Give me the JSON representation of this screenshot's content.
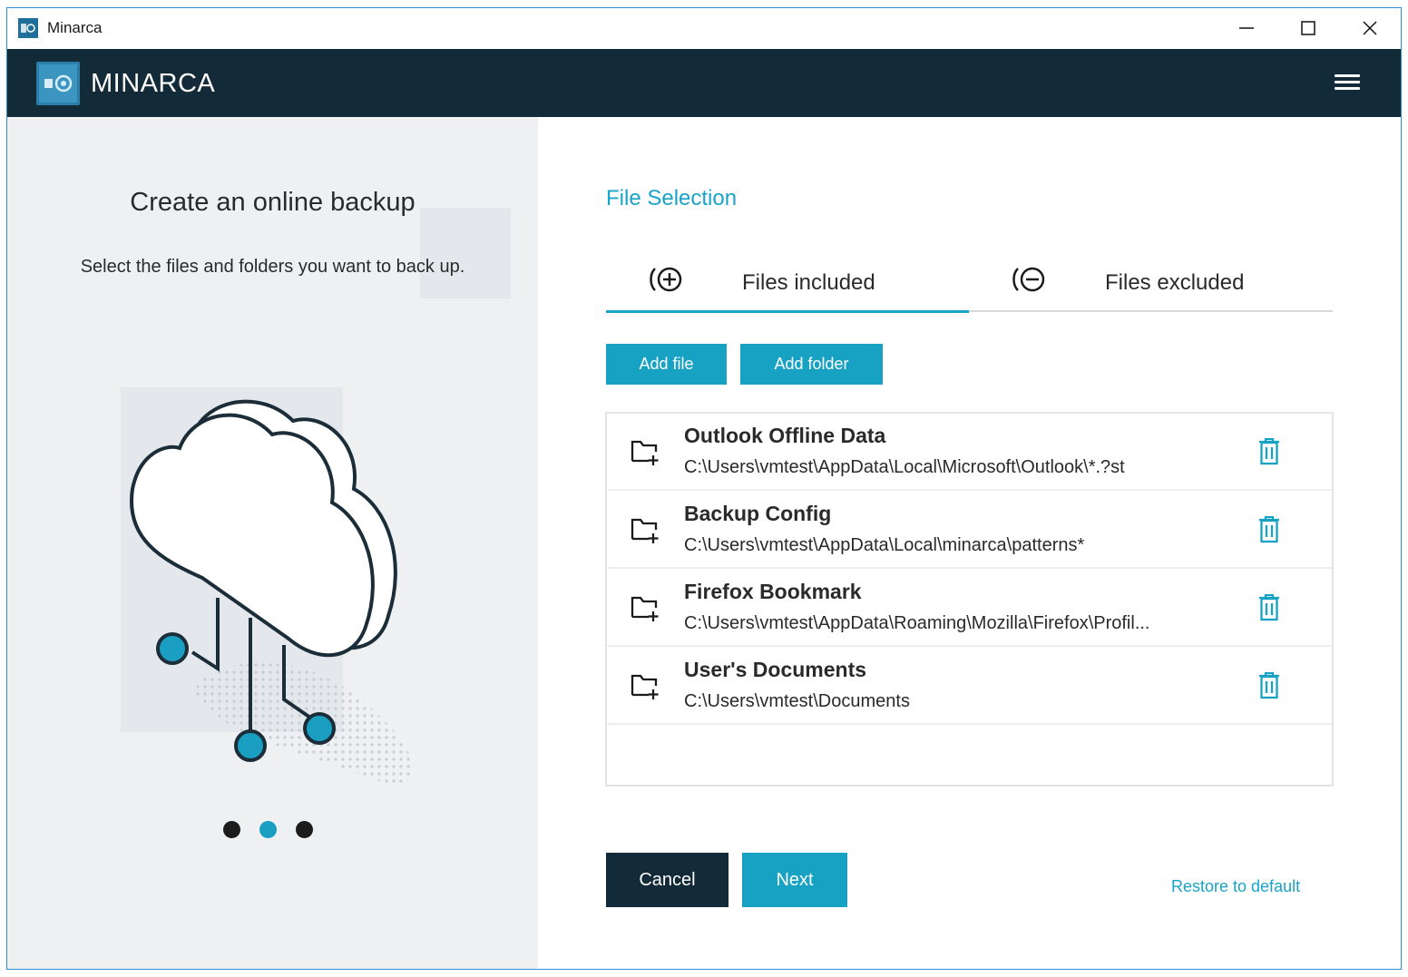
{
  "window": {
    "title": "Minarca",
    "controls": [
      "minimize",
      "maximize",
      "close"
    ]
  },
  "header": {
    "brand": "MINARCA",
    "menu_icon": "hamburger-menu-icon"
  },
  "left_panel": {
    "heading": "Create an online backup",
    "subtitle": "Select the files and folders you want to back up.",
    "pager": {
      "count": 3,
      "active_index": 1
    }
  },
  "file_selection": {
    "title": "File Selection",
    "tabs": [
      {
        "label": "Files included",
        "icon": "add-circle-icon",
        "active": true
      },
      {
        "label": "Files excluded",
        "icon": "remove-circle-icon",
        "active": false
      }
    ],
    "add_file_label": "Add file",
    "add_folder_label": "Add folder",
    "items": [
      {
        "title": "Outlook Offline Data",
        "path": "C:\\Users\\vmtest\\AppData\\Local\\Microsoft\\Outlook\\*.?st"
      },
      {
        "title": "Backup Config",
        "path": "C:\\Users\\vmtest\\AppData\\Local\\minarca\\patterns*"
      },
      {
        "title": "Firefox Bookmark",
        "path": "C:\\Users\\vmtest\\AppData\\Roaming\\Mozilla\\Firefox\\Profil..."
      },
      {
        "title": "User's Documents",
        "path": "C:\\Users\\vmtest\\Documents"
      }
    ]
  },
  "footer": {
    "cancel_label": "Cancel",
    "next_label": "Next",
    "restore_label": "Restore to default"
  },
  "colors": {
    "accent": "#17a2c4",
    "dark": "#132a38",
    "panel_bg": "#eef0f2"
  }
}
